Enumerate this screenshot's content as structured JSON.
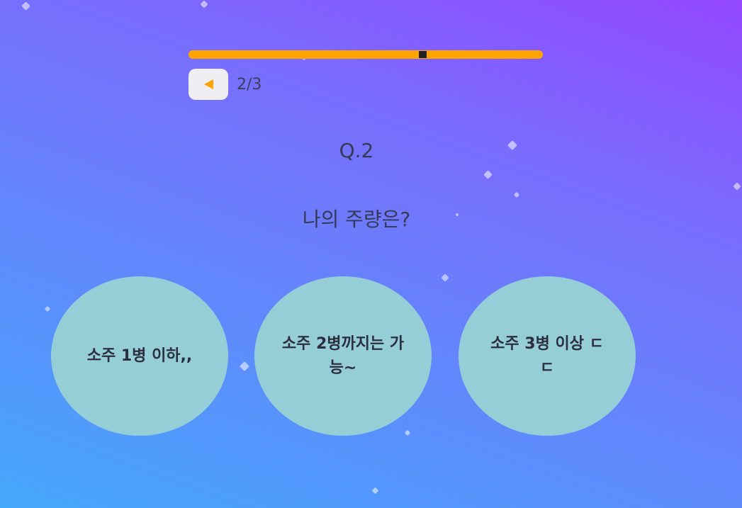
{
  "progress": {
    "value": 0.66,
    "counter": "2/3"
  },
  "question": {
    "number": "Q.2",
    "text": "나의 주량은?"
  },
  "answers": [
    "소주 1병 이하,,",
    "소주 2병까지는 가능~",
    "소주 3병 이상 ㄷㄷ"
  ],
  "colors": {
    "accent": "#ffa400",
    "answer_bg": "#95ced6",
    "button_bg": "#eeeef3",
    "gradient_start": "#44a8fc",
    "gradient_end": "#9347fe"
  },
  "icons": {
    "back": "back-arrow-icon"
  }
}
